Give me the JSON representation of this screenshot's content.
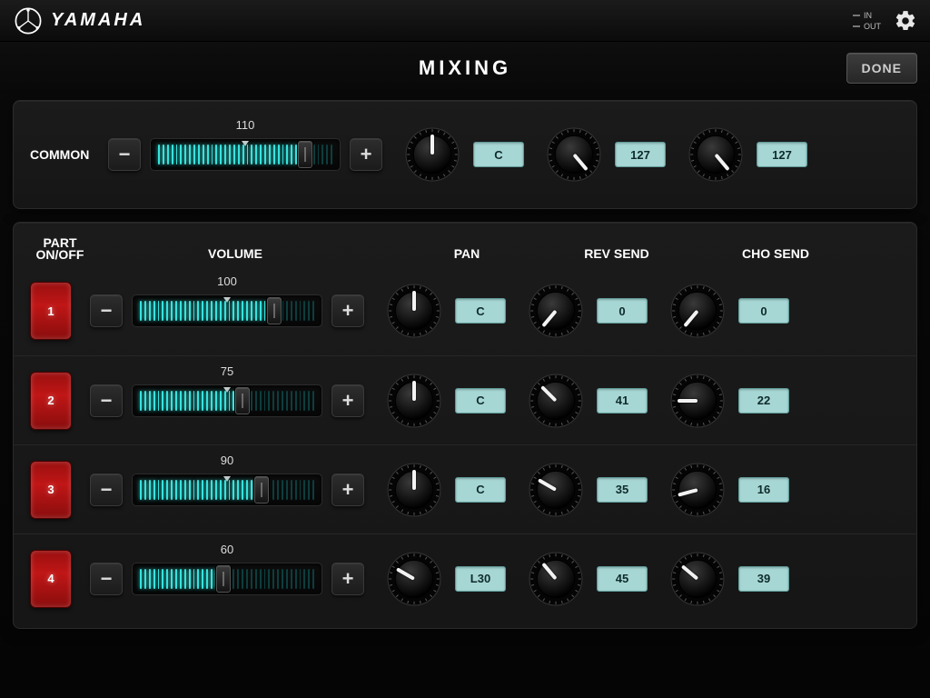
{
  "brand": "YAMAHA",
  "header": {
    "io_in": "IN",
    "io_out": "OUT"
  },
  "titlebar": {
    "title": "MIXING",
    "done": "DONE"
  },
  "columns": {
    "part": "PART\nON/OFF",
    "volume": "VOLUME",
    "pan": "PAN",
    "rev": "REV SEND",
    "cho": "CHO SEND"
  },
  "common": {
    "label": "COMMON",
    "volume": 110,
    "volume_max": 127,
    "pan": {
      "display": "C",
      "angle": 0
    },
    "rev": {
      "display": "127",
      "angle": 140
    },
    "cho": {
      "display": "127",
      "angle": 140
    }
  },
  "parts": [
    {
      "num": "1",
      "volume": 100,
      "volume_max": 127,
      "pan": {
        "display": "C",
        "angle": 0
      },
      "rev": {
        "display": "0",
        "angle": -140
      },
      "cho": {
        "display": "0",
        "angle": -140
      }
    },
    {
      "num": "2",
      "volume": 75,
      "volume_max": 127,
      "pan": {
        "display": "C",
        "angle": 0
      },
      "rev": {
        "display": "41",
        "angle": -45
      },
      "cho": {
        "display": "22",
        "angle": -90
      }
    },
    {
      "num": "3",
      "volume": 90,
      "volume_max": 127,
      "pan": {
        "display": "C",
        "angle": 0
      },
      "rev": {
        "display": "35",
        "angle": -60
      },
      "cho": {
        "display": "16",
        "angle": -105
      }
    },
    {
      "num": "4",
      "volume": 60,
      "volume_max": 127,
      "pan": {
        "display": "L30",
        "angle": -60
      },
      "rev": {
        "display": "45",
        "angle": -40
      },
      "cho": {
        "display": "39",
        "angle": -50
      }
    }
  ]
}
